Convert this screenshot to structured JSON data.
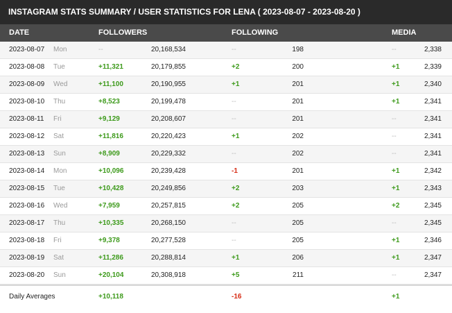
{
  "title": "INSTAGRAM STATS SUMMARY / USER STATISTICS FOR LENA ( 2023-08-07 - 2023-08-20 )",
  "headers": {
    "date": "DATE",
    "followers": "FOLLOWERS",
    "following": "FOLLOWING",
    "media": "MEDIA"
  },
  "rows": [
    {
      "date": "2023-08-07",
      "day": "Mon",
      "followers_delta": "--",
      "followers": "20,168,534",
      "following_delta": "--",
      "following": "198",
      "media_delta": "--",
      "media": "2,338"
    },
    {
      "date": "2023-08-08",
      "day": "Tue",
      "followers_delta": "+11,321",
      "followers": "20,179,855",
      "following_delta": "+2",
      "following": "200",
      "media_delta": "+1",
      "media": "2,339"
    },
    {
      "date": "2023-08-09",
      "day": "Wed",
      "followers_delta": "+11,100",
      "followers": "20,190,955",
      "following_delta": "+1",
      "following": "201",
      "media_delta": "+1",
      "media": "2,340"
    },
    {
      "date": "2023-08-10",
      "day": "Thu",
      "followers_delta": "+8,523",
      "followers": "20,199,478",
      "following_delta": "--",
      "following": "201",
      "media_delta": "+1",
      "media": "2,341"
    },
    {
      "date": "2023-08-11",
      "day": "Fri",
      "followers_delta": "+9,129",
      "followers": "20,208,607",
      "following_delta": "--",
      "following": "201",
      "media_delta": "--",
      "media": "2,341"
    },
    {
      "date": "2023-08-12",
      "day": "Sat",
      "followers_delta": "+11,816",
      "followers": "20,220,423",
      "following_delta": "+1",
      "following": "202",
      "media_delta": "--",
      "media": "2,341"
    },
    {
      "date": "2023-08-13",
      "day": "Sun",
      "followers_delta": "+8,909",
      "followers": "20,229,332",
      "following_delta": "--",
      "following": "202",
      "media_delta": "--",
      "media": "2,341"
    },
    {
      "date": "2023-08-14",
      "day": "Mon",
      "followers_delta": "+10,096",
      "followers": "20,239,428",
      "following_delta": "-1",
      "following": "201",
      "media_delta": "+1",
      "media": "2,342"
    },
    {
      "date": "2023-08-15",
      "day": "Tue",
      "followers_delta": "+10,428",
      "followers": "20,249,856",
      "following_delta": "+2",
      "following": "203",
      "media_delta": "+1",
      "media": "2,343"
    },
    {
      "date": "2023-08-16",
      "day": "Wed",
      "followers_delta": "+7,959",
      "followers": "20,257,815",
      "following_delta": "+2",
      "following": "205",
      "media_delta": "+2",
      "media": "2,345"
    },
    {
      "date": "2023-08-17",
      "day": "Thu",
      "followers_delta": "+10,335",
      "followers": "20,268,150",
      "following_delta": "--",
      "following": "205",
      "media_delta": "--",
      "media": "2,345"
    },
    {
      "date": "2023-08-18",
      "day": "Fri",
      "followers_delta": "+9,378",
      "followers": "20,277,528",
      "following_delta": "--",
      "following": "205",
      "media_delta": "+1",
      "media": "2,346"
    },
    {
      "date": "2023-08-19",
      "day": "Sat",
      "followers_delta": "+11,286",
      "followers": "20,288,814",
      "following_delta": "+1",
      "following": "206",
      "media_delta": "+1",
      "media": "2,347"
    },
    {
      "date": "2023-08-20",
      "day": "Sun",
      "followers_delta": "+20,104",
      "followers": "20,308,918",
      "following_delta": "+5",
      "following": "211",
      "media_delta": "--",
      "media": "2,347"
    }
  ],
  "averages": {
    "label": "Daily Averages",
    "followers": "+10,118",
    "following": "-16",
    "media": "+1"
  },
  "colors": {
    "positive": "#3d9a1b",
    "negative": "#d62b14",
    "empty": "#bbbbbb",
    "title_bg": "#2a2a2a",
    "header_bg": "#4a4a4a"
  }
}
